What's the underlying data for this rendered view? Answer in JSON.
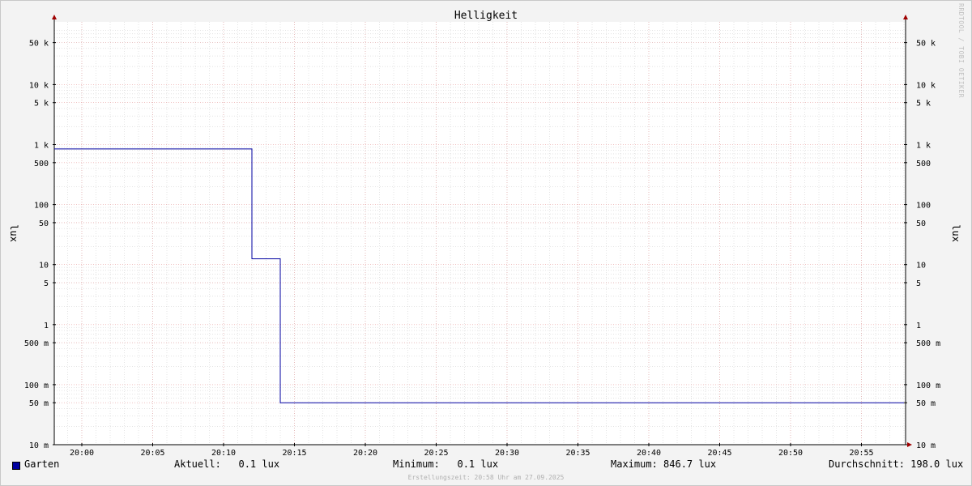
{
  "chart_data": {
    "type": "line",
    "title": "Helligkeit",
    "ylabel": "lux",
    "yscale": "log",
    "ylim": [
      0.01,
      80000
    ],
    "x_ticks": [
      "20:00",
      "20:05",
      "20:10",
      "20:15",
      "20:20",
      "20:25",
      "20:30",
      "20:35",
      "20:40",
      "20:45",
      "20:50",
      "20:55"
    ],
    "y_ticks": [
      {
        "value": 50000,
        "label": "50 k"
      },
      {
        "value": 10000,
        "label": "10 k"
      },
      {
        "value": 5000,
        "label": "5 k"
      },
      {
        "value": 1000,
        "label": "1 k"
      },
      {
        "value": 500,
        "label": "500"
      },
      {
        "value": 100,
        "label": "100"
      },
      {
        "value": 50,
        "label": "50"
      },
      {
        "value": 10,
        "label": "10"
      },
      {
        "value": 5,
        "label": "5"
      },
      {
        "value": 1,
        "label": "1"
      },
      {
        "value": 0.5,
        "label": "500 m"
      },
      {
        "value": 0.1,
        "label": "100 m"
      },
      {
        "value": 0.05,
        "label": "50 m"
      },
      {
        "value": 0.01,
        "label": "10 m"
      }
    ],
    "series": [
      {
        "name": "Garten",
        "color": "#0000a0",
        "x": [
          "19:58",
          "20:12",
          "20:12",
          "20:14",
          "20:14",
          "20:58"
        ],
        "values": [
          846.7,
          846.7,
          12.5,
          12.5,
          0.05,
          0.05
        ]
      }
    ],
    "grid": true,
    "legend": "bottom"
  },
  "legend": {
    "series_name": "Garten",
    "aktuell": "Aktuell:   0.1 lux",
    "minimum": "Minimum:   0.1 lux",
    "maximum": "Maximum: 846.7 lux",
    "durchschnitt": "Durchschnitt: 198.0 lux"
  },
  "footer": "Erstellungszeit: 20:58 Uhr am 27.09.2025",
  "watermark": "RRDTOOL / TOBI OETIKER",
  "colors": {
    "background": "#f3f3f3",
    "plot": "#ffffff",
    "major_grid": "#e8a0a0",
    "minor_grid": "#c8c8c8",
    "line": "#0000a0",
    "arrow": "#a00000"
  }
}
